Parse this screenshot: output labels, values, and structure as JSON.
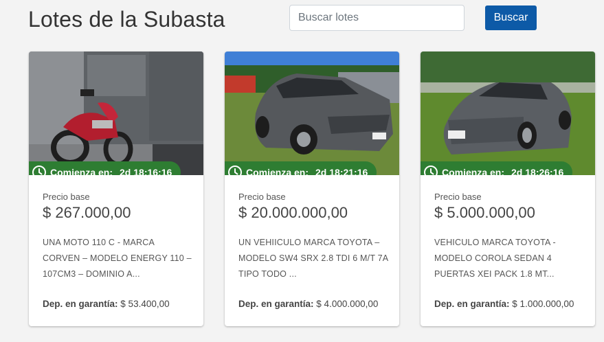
{
  "header": {
    "title": "Lotes de la Subasta"
  },
  "search": {
    "placeholder": "Buscar lotes",
    "value": "",
    "button_label": "Buscar"
  },
  "colors": {
    "primary": "#0d5aa7",
    "countdown_bg": "#2e7d32"
  },
  "lots": [
    {
      "countdown_label": "Comienza en:",
      "countdown_value": "2d 18:16:16",
      "base_label": "Precio base",
      "price": "$ 267.000,00",
      "description": "UNA MOTO 110 C - MARCA CORVEN – MODELO ENERGY 110 – 107CM3 – DOMINIO A...",
      "guarantee_label": "Dep. en garantía:",
      "guarantee_value": "$ 53.400,00"
    },
    {
      "countdown_label": "Comienza en:",
      "countdown_value": "2d 18:21:16",
      "base_label": "Precio base",
      "price": "$ 20.000.000,00",
      "description": "UN VEHIICULO MARCA TOYOTA – MODELO SW4 SRX 2.8 TDI 6 M/T 7A TIPO TODO ...",
      "guarantee_label": "Dep. en garantía:",
      "guarantee_value": "$ 4.000.000,00"
    },
    {
      "countdown_label": "Comienza en:",
      "countdown_value": "2d 18:26:16",
      "base_label": "Precio base",
      "price": "$ 5.000.000,00",
      "description": "VEHICULO MARCA TOYOTA - MODELO COROLA SEDAN 4 PUERTAS XEI PACK 1.8 MT...",
      "guarantee_label": "Dep. en garantía:",
      "guarantee_value": "$ 1.000.000,00"
    }
  ]
}
